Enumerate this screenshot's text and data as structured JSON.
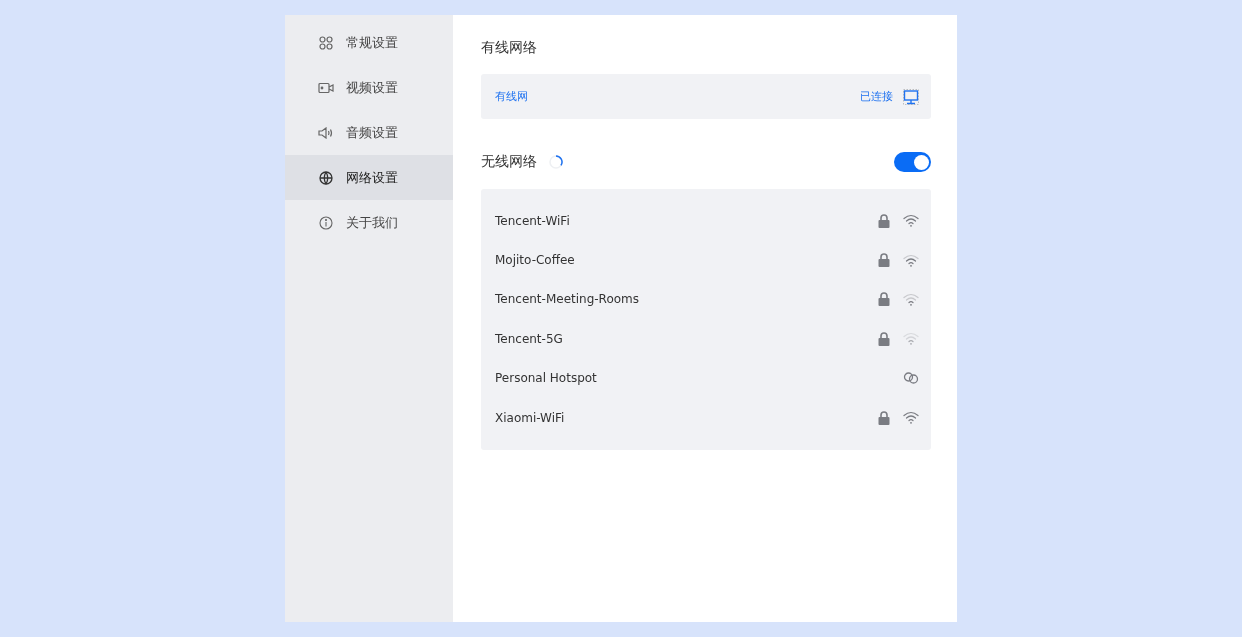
{
  "sidebar": {
    "items": [
      {
        "label": "常规设置",
        "selected": false
      },
      {
        "label": "视频设置",
        "selected": false
      },
      {
        "label": "音频设置",
        "selected": false
      },
      {
        "label": "网络设置",
        "selected": true
      },
      {
        "label": "关于我们",
        "selected": false
      }
    ]
  },
  "wired": {
    "title": "有线网络",
    "name": "有线网",
    "status": "已连接"
  },
  "wireless": {
    "title": "无线网络",
    "loading": true,
    "on": true,
    "networks": [
      {
        "name": "Tencent-WiFi",
        "kind": "locked"
      },
      {
        "name": "Mojito-Coffee",
        "kind": "locked"
      },
      {
        "name": "Tencent-Meeting-Rooms",
        "kind": "locked"
      },
      {
        "name": "Tencent-5G",
        "kind": "locked"
      },
      {
        "name": "Personal Hotspot",
        "kind": "hotspot"
      },
      {
        "name": "Xiaomi-WiFi",
        "kind": "locked"
      }
    ]
  }
}
